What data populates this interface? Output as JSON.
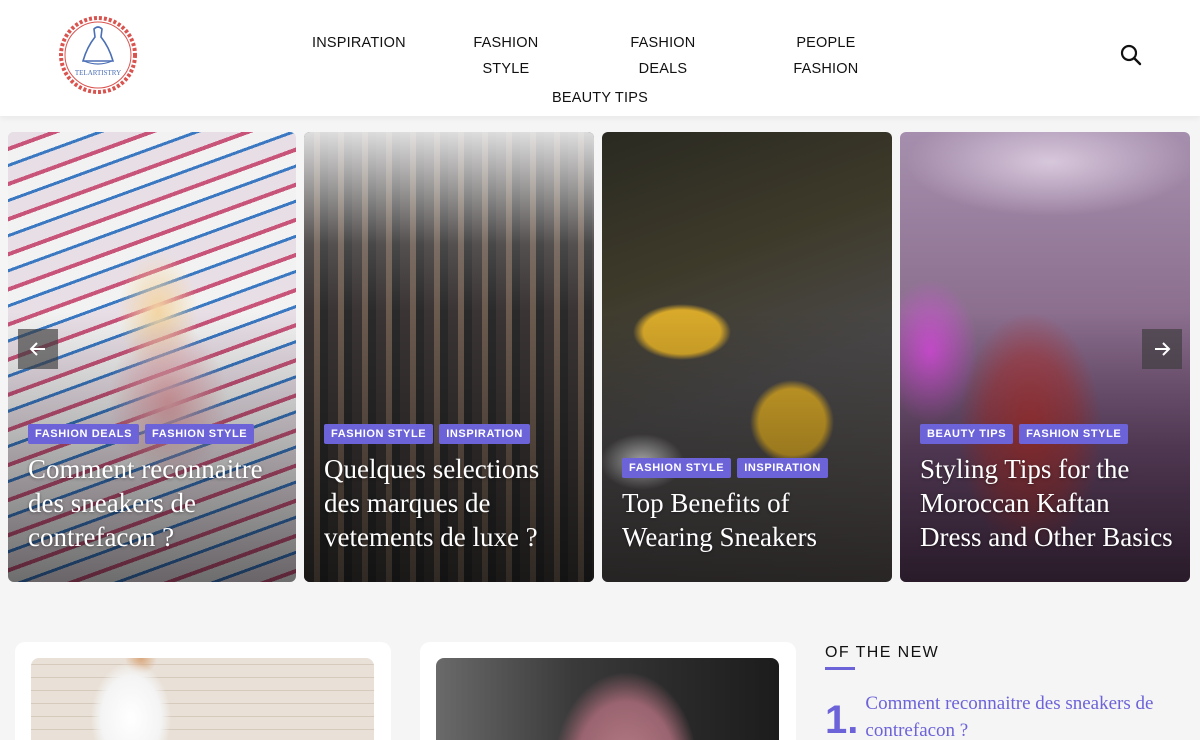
{
  "brand": {
    "logo_text": "TELARTISTRY",
    "accent": "#6c63d9"
  },
  "nav": {
    "items": [
      "INSPIRATION",
      "FASHION STYLE",
      "FASHION DEALS",
      "PEOPLE FASHION"
    ],
    "second_row": [
      "BEAUTY TIPS"
    ]
  },
  "slides": [
    {
      "tags": [
        "FASHION DEALS",
        "FASHION STYLE"
      ],
      "title": "Comment reconnaitre des sneakers de contrefacon ?"
    },
    {
      "tags": [
        "FASHION STYLE",
        "INSPIRATION"
      ],
      "title": "Quelques selections des marques de vetements de luxe ?"
    },
    {
      "tags": [
        "FASHION STYLE",
        "INSPIRATION"
      ],
      "title": "Top Benefits of Wearing Sneakers"
    },
    {
      "tags": [
        "BEAUTY TIPS",
        "FASHION STYLE"
      ],
      "title": "Styling Tips for the Moroccan Kaftan Dress and Other Basics"
    }
  ],
  "sidebar": {
    "title": "OF THE NEW",
    "items": [
      {
        "num": "1.",
        "title": "Comment reconnaitre des sneakers de contrefacon ?"
      }
    ]
  },
  "icons": {
    "search": "search-icon",
    "prev": "arrow-left-icon",
    "next": "arrow-right-icon"
  }
}
